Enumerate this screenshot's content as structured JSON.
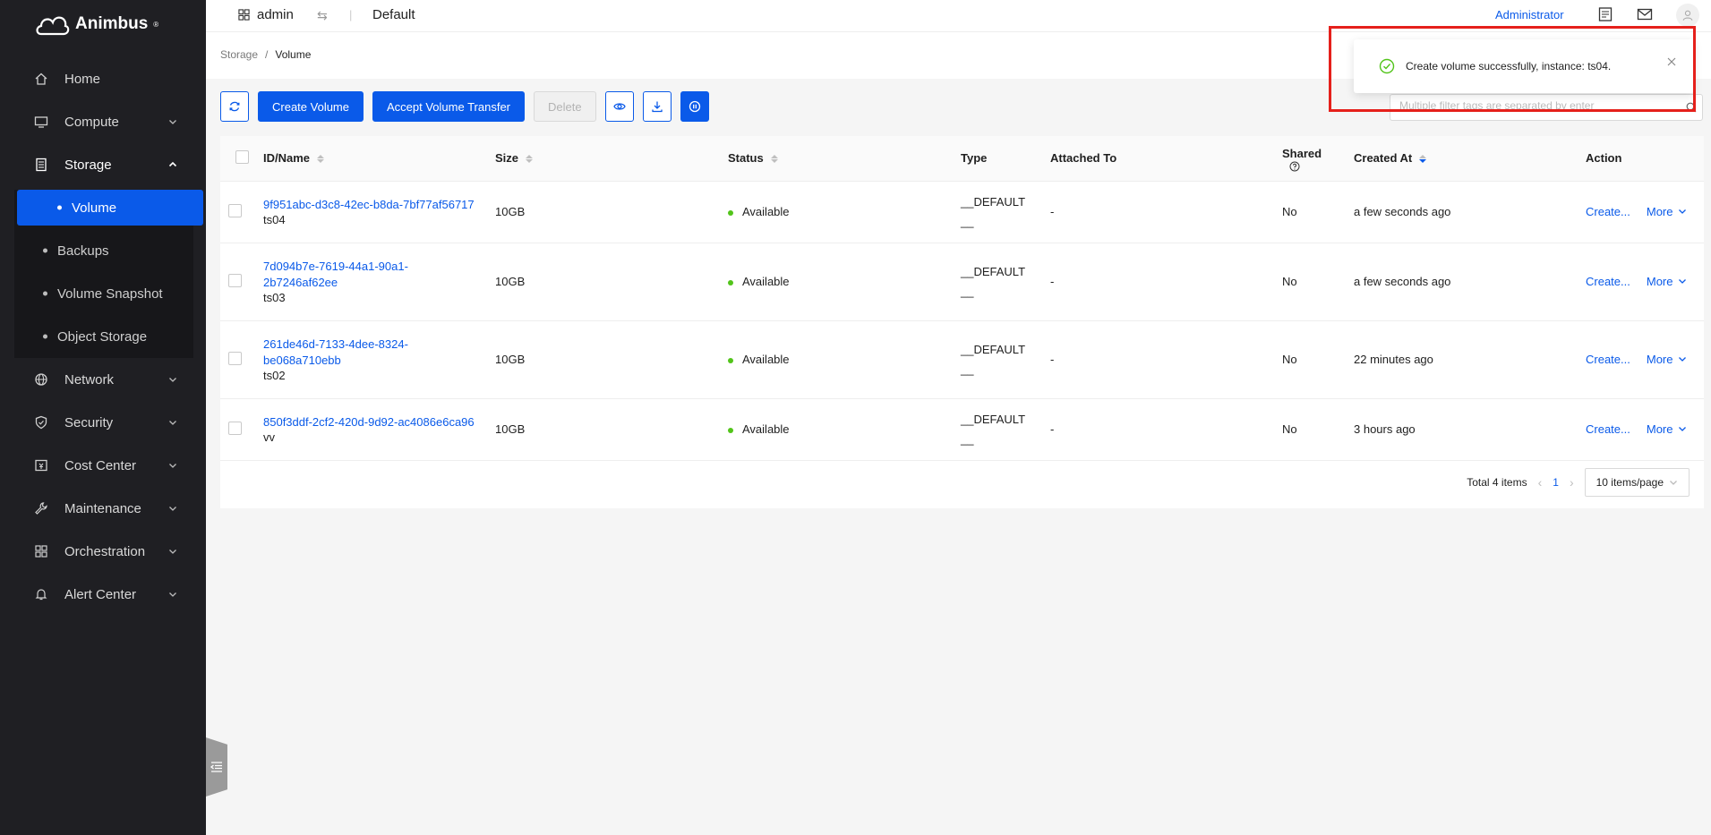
{
  "brand": {
    "name": "Animbus",
    "mark": "®"
  },
  "sidebar": {
    "items": [
      {
        "label": "Home",
        "icon": "home-icon"
      },
      {
        "label": "Compute",
        "icon": "monitor-icon"
      },
      {
        "label": "Storage",
        "icon": "storage-icon"
      },
      {
        "label": "Network",
        "icon": "globe-icon"
      },
      {
        "label": "Security",
        "icon": "shield-icon"
      },
      {
        "label": "Cost Center",
        "icon": "cost-icon"
      },
      {
        "label": "Maintenance",
        "icon": "wrench-icon"
      },
      {
        "label": "Orchestration",
        "icon": "grid-icon"
      },
      {
        "label": "Alert Center",
        "icon": "bell-icon"
      }
    ],
    "storage_sub": [
      {
        "label": "Volume"
      },
      {
        "label": "Backups"
      },
      {
        "label": "Volume Snapshot"
      },
      {
        "label": "Object Storage"
      }
    ]
  },
  "topbar": {
    "project": "admin",
    "domain": "Default",
    "role": "Administrator"
  },
  "breadcrumb": {
    "parent": "Storage",
    "separator": "/",
    "current": "Volume"
  },
  "toolbar": {
    "create": "Create Volume",
    "accept": "Accept Volume Transfer",
    "delete": "Delete"
  },
  "search": {
    "placeholder": "Multiple filter tags are separated by enter"
  },
  "table": {
    "headers": {
      "id_name": "ID/Name",
      "size": "Size",
      "status": "Status",
      "type": "Type",
      "attached": "Attached To",
      "shared": "Shared",
      "created": "Created At",
      "action": "Action"
    },
    "rows": [
      {
        "id_line1": "9f951abc-d3c8-42ec-b8da-7bf77af56717",
        "id_line2": "",
        "name": "ts04",
        "size": "10GB",
        "status": "Available",
        "type_line1": "__DEFAULT",
        "type_line2": "__",
        "attached": "-",
        "shared": "No",
        "created": "a few seconds ago",
        "action": "Create...",
        "more": "More"
      },
      {
        "id_line1": "7d094b7e-7619-44a1-90a1-",
        "id_line2": "2b7246af62ee",
        "name": "ts03",
        "size": "10GB",
        "status": "Available",
        "type_line1": "__DEFAULT",
        "type_line2": "__",
        "attached": "-",
        "shared": "No",
        "created": "a few seconds ago",
        "action": "Create...",
        "more": "More"
      },
      {
        "id_line1": "261de46d-7133-4dee-8324-",
        "id_line2": "be068a710ebb",
        "name": "ts02",
        "size": "10GB",
        "status": "Available",
        "type_line1": "__DEFAULT",
        "type_line2": "__",
        "attached": "-",
        "shared": "No",
        "created": "22 minutes ago",
        "action": "Create...",
        "more": "More"
      },
      {
        "id_line1": "850f3ddf-2cf2-420d-9d92-ac4086e6ca96",
        "id_line2": "",
        "name": "vv",
        "size": "10GB",
        "status": "Available",
        "type_line1": "__DEFAULT",
        "type_line2": "__",
        "attached": "-",
        "shared": "No",
        "created": "3 hours ago",
        "action": "Create...",
        "more": "More"
      }
    ]
  },
  "pagination": {
    "total": "Total 4 items",
    "page": "1",
    "page_size": "10 items/page"
  },
  "notification": {
    "message": "Create volume successfully, instance: ts04."
  },
  "colors": {
    "primary": "#0a5ae9",
    "sidebar_bg": "#1f1f23",
    "success": "#52c41a",
    "highlight": "#e5201b"
  }
}
